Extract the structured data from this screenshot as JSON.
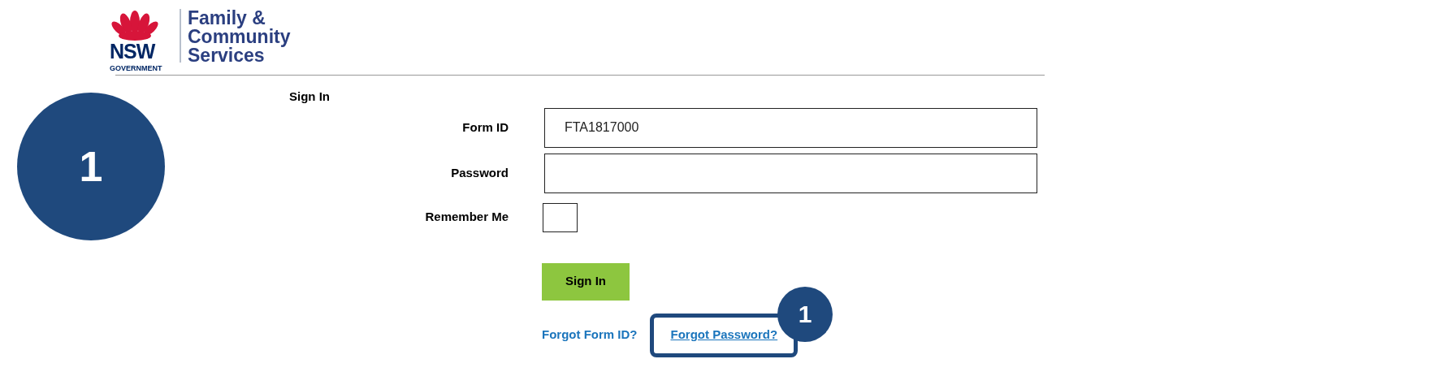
{
  "logo": {
    "wordmark": "NSW",
    "subtitle": "GOVERNMENT",
    "lines": [
      "Family &",
      "Community",
      "Services"
    ]
  },
  "step_marker": "1",
  "form": {
    "title": "Sign In",
    "fields": [
      {
        "kind": "text",
        "label": "Form ID",
        "value": "FTA1817000"
      },
      {
        "kind": "password",
        "label": "Password"
      },
      {
        "kind": "checkbox",
        "label": "Remember Me",
        "checked": false
      }
    ],
    "submit": "Sign In",
    "links": [
      {
        "label": "Forgot Form ID?",
        "highlighted": false
      },
      {
        "label": "Forgot Password?",
        "highlighted": true,
        "callout": "1"
      }
    ]
  }
}
